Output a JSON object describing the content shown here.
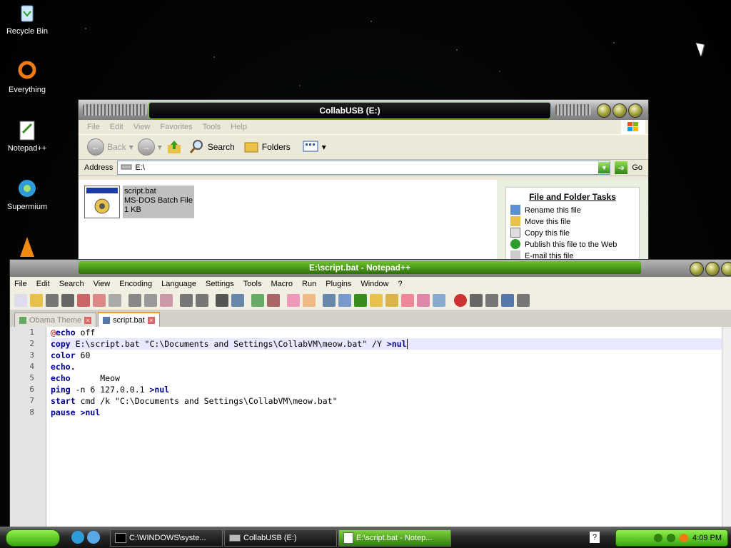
{
  "desktop": {
    "icons": [
      {
        "label": "Recycle Bin",
        "icon": "recycle-bin-icon"
      },
      {
        "label": "Everything",
        "icon": "everything-icon"
      },
      {
        "label": "Notepad++",
        "icon": "notepadpp-icon"
      },
      {
        "label": "Supermium",
        "icon": "supermium-icon"
      },
      {
        "label": "",
        "icon": "vlc-icon"
      }
    ]
  },
  "explorer": {
    "title": "CollabUSB (E:)",
    "menu": [
      "File",
      "Edit",
      "View",
      "Favorites",
      "Tools",
      "Help"
    ],
    "toolbar": {
      "back": "Back",
      "search": "Search",
      "folders": "Folders"
    },
    "address_label": "Address",
    "address_value": "E:\\",
    "go_label": "Go",
    "file": {
      "name": "script.bat",
      "type": "MS-DOS Batch File",
      "size": "1 KB"
    },
    "tasks_title": "File and Folder Tasks",
    "tasks": [
      "Rename this file",
      "Move this file",
      "Copy this file",
      "Publish this file to the Web",
      "E-mail this file"
    ]
  },
  "notepad": {
    "title": "E:\\script.bat - Notepad++",
    "menu": [
      "File",
      "Edit",
      "Search",
      "View",
      "Encoding",
      "Language",
      "Settings",
      "Tools",
      "Macro",
      "Run",
      "Plugins",
      "Window",
      "?"
    ],
    "tabs": [
      {
        "label": "Obama Theme"
      },
      {
        "label": "script.bat"
      }
    ],
    "line_numbers": [
      "1",
      "2",
      "3",
      "4",
      "5",
      "6",
      "7",
      "8"
    ],
    "code": {
      "l1a": "@",
      "l1b": "echo",
      "l1c": " off",
      "l2a": "copy",
      "l2b": " E:\\script.bat \"C:\\Documents and Settings\\CollabVM\\meow.bat\" /Y ",
      "l2c": ">nul",
      "l3a": "color",
      "l3b": " 60",
      "l4a": "echo.",
      "l5a": "echo",
      "l5b": "      Meow",
      "l6a": "ping",
      "l6b": " -n 6 127.0.0.1 ",
      "l6c": ">nul",
      "l7a": "start",
      "l7b": " cmd /k \"C:\\Documents and Settings\\CollabVM\\meow.bat\"",
      "l8a": "pause",
      "l8b": " ",
      "l8c": ">nul"
    }
  },
  "taskbar": {
    "tasks": [
      "C:\\WINDOWS\\syste...",
      "CollabUSB (E:)",
      "E:\\script.bat - Notep..."
    ],
    "clock": "4:09 PM"
  }
}
